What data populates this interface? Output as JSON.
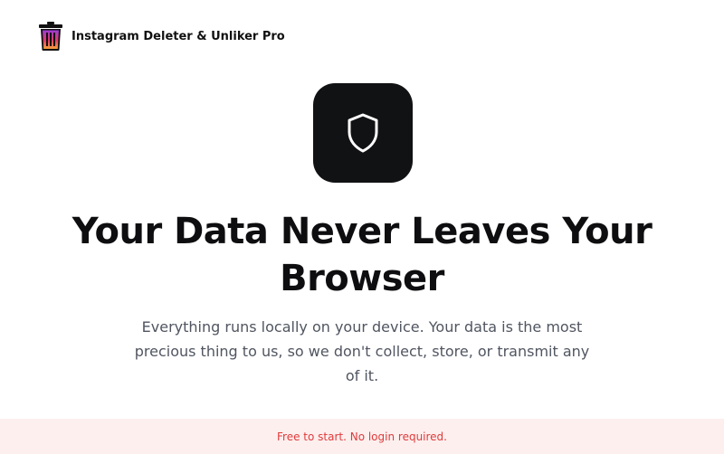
{
  "header": {
    "app_title": "Instagram Deleter & Unliker Pro",
    "logo_icon": "trash-bin-icon"
  },
  "hero": {
    "icon": "shield-icon",
    "title": "Your Data Never Leaves Your Browser",
    "subtitle": "Everything runs locally on your device. Your data is the most precious thing to us, so we don't collect, store, or transmit any of it."
  },
  "banner": {
    "text": "Free to start. No login required."
  },
  "colors": {
    "banner_bg": "#fcefee",
    "banner_text": "#e03b3b",
    "icon_tile": "#111214",
    "logo_gradient_top": "#9b3bd6",
    "logo_gradient_bottom": "#f6a33b"
  }
}
